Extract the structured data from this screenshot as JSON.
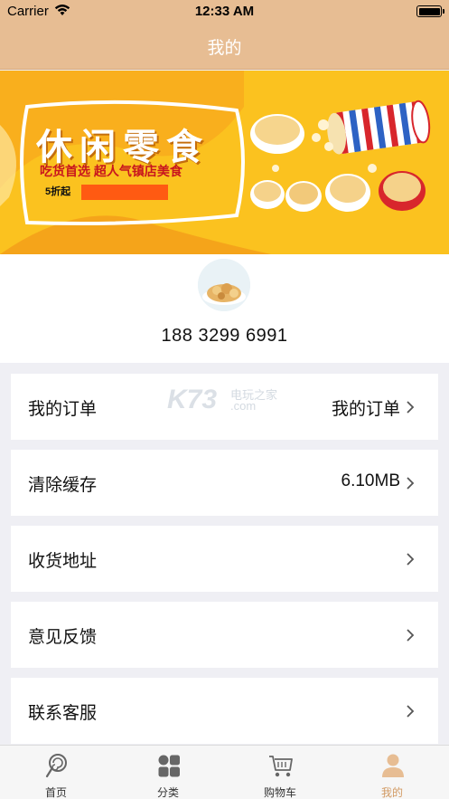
{
  "status_bar": {
    "carrier": "Carrier",
    "time": "12:33 AM"
  },
  "nav": {
    "title": "我的"
  },
  "banner": {
    "headline": "休闲零食",
    "slogan": "吃货首选 超人气镇店美食",
    "promo": "5折起"
  },
  "profile": {
    "phone": "188 3299 6991"
  },
  "menu": [
    {
      "label": "我的订单",
      "value": "我的订单"
    },
    {
      "label": "清除缓存",
      "value": "6.10MB"
    },
    {
      "label": "收货地址",
      "value": ""
    },
    {
      "label": "意见反馈",
      "value": ""
    },
    {
      "label": "联系客服",
      "value": ""
    }
  ],
  "watermark": {
    "text": "K73",
    "sub": "电玩之家",
    "domain": ".com"
  },
  "tabs": [
    {
      "label": "首页",
      "icon": "lollipop-icon",
      "active": false
    },
    {
      "label": "分类",
      "icon": "category-grid-icon",
      "active": false
    },
    {
      "label": "购物车",
      "icon": "cart-icon",
      "active": false
    },
    {
      "label": "我的",
      "icon": "person-icon",
      "active": true
    }
  ],
  "colors": {
    "accent": "#e7bd93",
    "active_tab": "#d29a63",
    "banner_bg": "#fbc21f"
  }
}
